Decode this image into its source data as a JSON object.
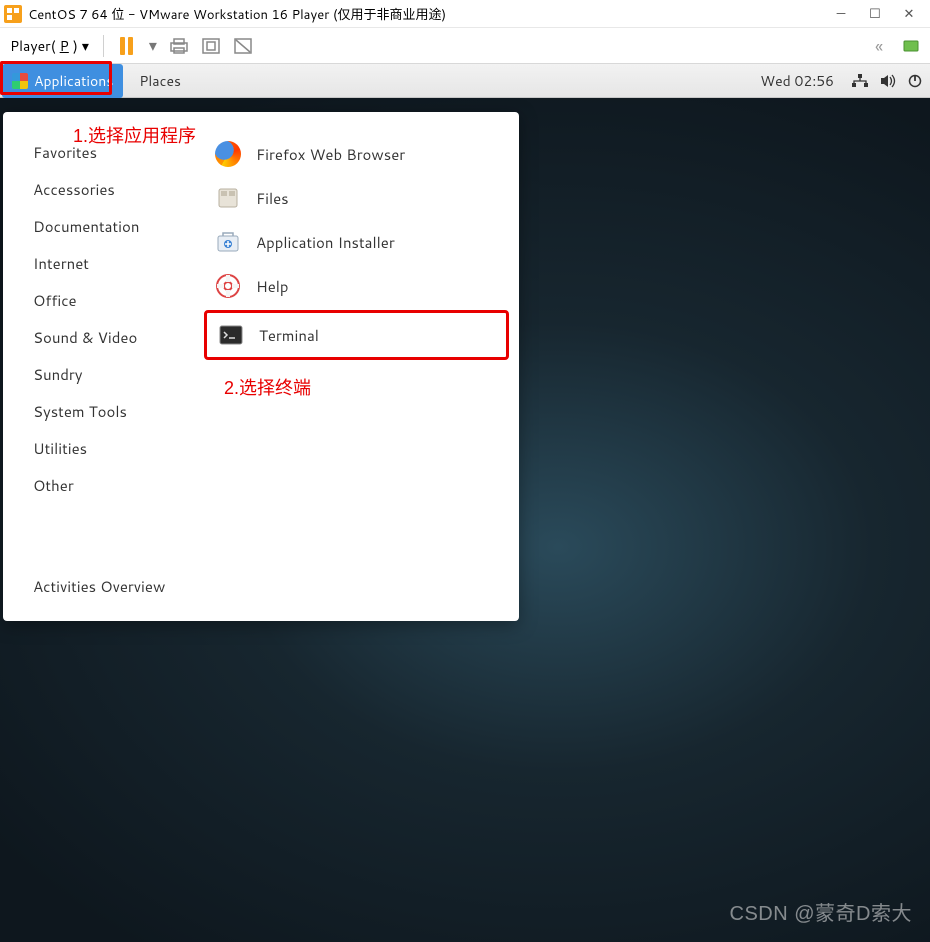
{
  "vmware": {
    "title": "CentOS 7 64 位 - VMware Workstation 16 Player (仅用于非商业用途)",
    "player_menu_prefix": "Player(",
    "player_menu_key": "P",
    "player_menu_suffix": ")"
  },
  "gnome": {
    "applications": "Applications",
    "places": "Places",
    "clock": "Wed 02:56"
  },
  "menu": {
    "categories": [
      "Favorites",
      "Accessories",
      "Documentation",
      "Internet",
      "Office",
      "Sound & Video",
      "Sundry",
      "System Tools",
      "Utilities",
      "Other"
    ],
    "items": [
      {
        "icon": "firefox-icon",
        "label": "Firefox Web Browser"
      },
      {
        "icon": "files-icon",
        "label": "Files"
      },
      {
        "icon": "application-installer-icon",
        "label": "Application Installer"
      },
      {
        "icon": "help-icon",
        "label": "Help"
      },
      {
        "icon": "terminal-icon",
        "label": "Terminal"
      }
    ],
    "activities": "Activities Overview"
  },
  "annotations": {
    "step1": "1.选择应用程序",
    "step2": "2.选择终端"
  },
  "watermark": "CSDN @蒙奇D索大"
}
